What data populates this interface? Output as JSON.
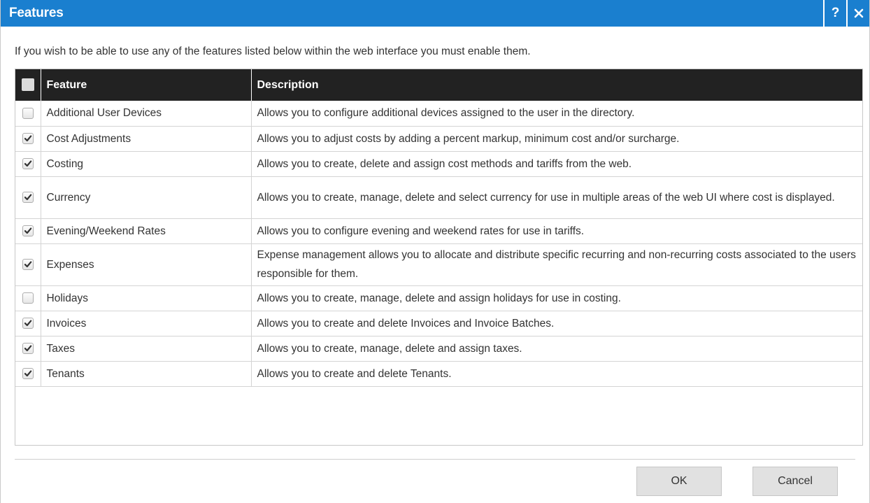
{
  "dialog": {
    "title": "Features",
    "help_label": "?",
    "intro": "If you wish to be able to use any of the features listed below within the web interface you must enable them."
  },
  "table": {
    "headers": {
      "feature": "Feature",
      "description": "Description"
    },
    "rows": [
      {
        "feature": "Additional User Devices",
        "description": "Allows you to configure additional devices assigned to the user in the directory.",
        "checked": false
      },
      {
        "feature": "Cost Adjustments",
        "description": "Allows you to adjust costs by adding a percent markup, minimum cost and/or surcharge.",
        "checked": true
      },
      {
        "feature": "Costing",
        "description": "Allows you to create, delete and assign cost methods and tariffs from the web.",
        "checked": true
      },
      {
        "feature": "Currency",
        "description": "Allows you to create, manage, delete and select currency for use in multiple areas of the web UI where cost is displayed.",
        "checked": true
      },
      {
        "feature": "Evening/Weekend Rates",
        "description": "Allows you to configure evening and weekend rates for use in tariffs.",
        "checked": true
      },
      {
        "feature": "Expenses",
        "description": "Expense management allows you to allocate and distribute specific recurring and non-recurring costs associated to the users responsible for them.",
        "checked": true
      },
      {
        "feature": "Holidays",
        "description": "Allows you to create, manage, delete and assign holidays for use in costing.",
        "checked": false
      },
      {
        "feature": "Invoices",
        "description": "Allows you to create and delete Invoices and Invoice Batches.",
        "checked": true
      },
      {
        "feature": "Taxes",
        "description": "Allows you to create, manage, delete and assign taxes.",
        "checked": true
      },
      {
        "feature": "Tenants",
        "description": "Allows you to create and delete Tenants.",
        "checked": true
      }
    ]
  },
  "buttons": {
    "ok": "OK",
    "cancel": "Cancel"
  },
  "colors": {
    "titlebar": "#1a7fcf",
    "header": "#222222"
  }
}
